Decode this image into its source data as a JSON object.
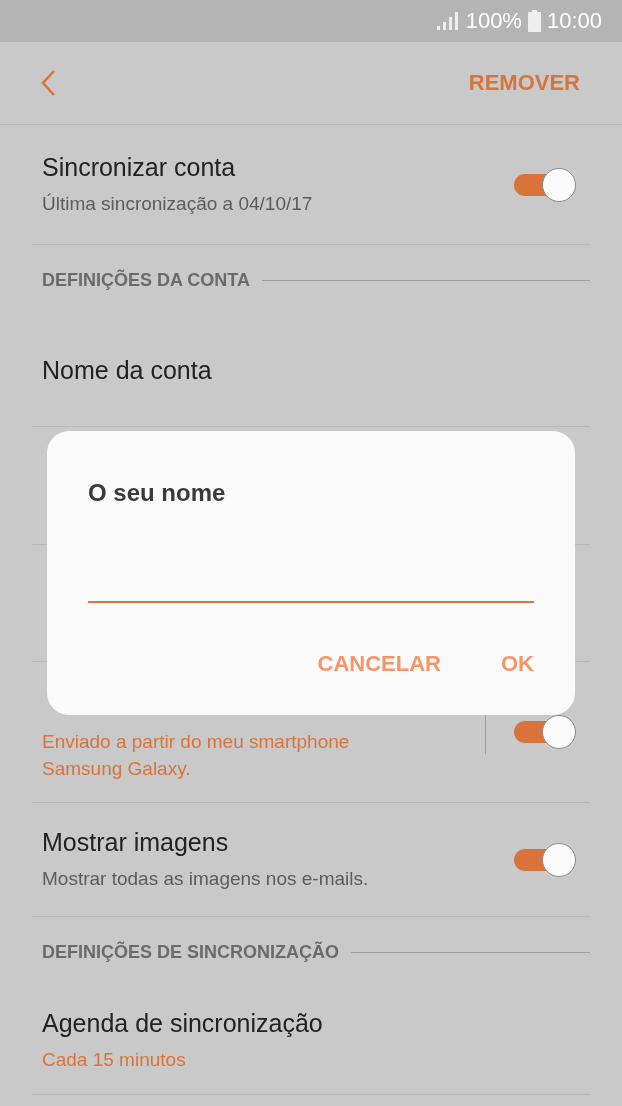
{
  "status_bar": {
    "battery": "100%",
    "time": "10:00"
  },
  "header": {
    "action": "REMOVER"
  },
  "items": [
    {
      "kind": "setting",
      "title": "Sincronizar conta",
      "subtitle": "Última sincronização a 04/10/17",
      "accent": false,
      "toggle": {
        "on": true
      }
    },
    {
      "kind": "section",
      "title": "DEFINIÇÕES DA CONTA"
    },
    {
      "kind": "setting",
      "title": "Nome da conta"
    },
    {
      "kind": "setting"
    },
    {
      "kind": "setting"
    },
    {
      "kind": "setting",
      "subtitle": "Enviado a partir do meu smartphone Samsung Galaxy.",
      "accent": true,
      "toggle": {
        "on": true
      },
      "split": true
    },
    {
      "kind": "setting",
      "title": "Mostrar imagens",
      "subtitle": "Mostrar todas as imagens nos e-mails.",
      "accent": false,
      "toggle": {
        "on": true
      }
    },
    {
      "kind": "section",
      "title": "DEFINIÇÕES DE SINCRONIZAÇÃO"
    },
    {
      "kind": "setting",
      "title": "Agenda de sincronização",
      "subtitle": "Cada 15 minutos",
      "accent": true
    }
  ],
  "dialog": {
    "title": "O seu nome",
    "field": {
      "focused": true
    },
    "buttons": [
      "CANCELAR",
      "OK"
    ]
  }
}
